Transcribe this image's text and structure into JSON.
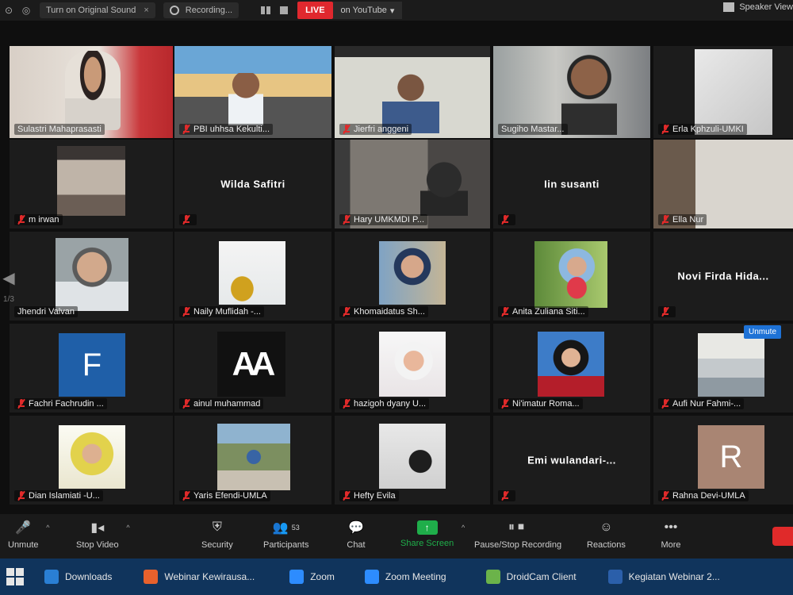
{
  "topbar": {
    "audio_label": "Turn on Original Sound",
    "audio_close": "×",
    "recording_label": "Recording...",
    "live_label": "LIVE",
    "youtube_label": "on YouTube",
    "youtube_caret": "▾",
    "view_label": "Speaker View"
  },
  "tiles": [
    {
      "name": "Sulastri Mahaprasasti"
    },
    {
      "name": "PBI uhhsa Kekulti..."
    },
    {
      "name": "Jierfri anggeni"
    },
    {
      "name": "Sugiho Mastar..."
    },
    {
      "name": "Erla Kphzuli-UMKI"
    },
    {
      "name": "m irwan"
    },
    {
      "name": "Wilda Safitri"
    },
    {
      "name": "Hary UMKMDI P..."
    },
    {
      "name": "Iin susanti"
    },
    {
      "name": "Ella Nur"
    },
    {
      "name": "Jhendri Valvan"
    },
    {
      "name": "Naily Muflidah -..."
    },
    {
      "name": "Khomaidatus Sh..."
    },
    {
      "name": "Anita Zuliana Siti..."
    },
    {
      "name": "Novi Firda Hida..."
    },
    {
      "name": "Fachri Fachrudin ..."
    },
    {
      "name": "ainul muhammad"
    },
    {
      "name": "hazigoh dyany U..."
    },
    {
      "name": "Ni'imatur Roma..."
    },
    {
      "name": "Aufi Nur Fahmi-..."
    },
    {
      "name": "Dian Islamiati -U..."
    },
    {
      "name": "Yaris Efendi-UMLA"
    },
    {
      "name": "Hefty Evila"
    },
    {
      "name": "Emi wulandari-..."
    },
    {
      "name": "Rahna Devi-UMLA"
    }
  ],
  "avatars": {
    "fachri_letter": "F",
    "fachri_color": "#1f5fa8",
    "rahna_letter": "R",
    "rahna_color": "#a98573",
    "ainul_logo_text": "AA"
  },
  "side": {
    "arrow": "◀",
    "page": "1/3"
  },
  "unmute_tip": "Unmute",
  "toolbar": {
    "unmute": "Unmute",
    "stop_video": "Stop Video",
    "security": "Security",
    "participants": "Participants",
    "participants_count": "53",
    "chat": "Chat",
    "share_screen": "Share Screen",
    "pause_stop_recording": "Pause/Stop Recording",
    "reactions": "Reactions",
    "more": "More",
    "caret": "^"
  },
  "taskbar": {
    "items": [
      {
        "label": "Downloads",
        "icon": "download-icon",
        "color": "#2a7fd4"
      },
      {
        "label": "Webinar Kewirausa...",
        "icon": "firefox-icon",
        "color": "#e8612c"
      },
      {
        "label": "Zoom",
        "icon": "zoom-icon",
        "color": "#2d8cff"
      },
      {
        "label": "Zoom Meeting",
        "icon": "zoom-icon",
        "color": "#2d8cff"
      },
      {
        "label": "DroidCam Client",
        "icon": "droidcam-icon",
        "color": "#6bb34a"
      },
      {
        "label": "Kegiatan Webinar 2...",
        "icon": "word-icon",
        "color": "#2b5faa"
      }
    ]
  },
  "colors": {
    "active_speaker_border": "#b6d64a",
    "live_red": "#e0282e",
    "share_green": "#1fae4a",
    "taskbar_blue": "#10345c"
  }
}
